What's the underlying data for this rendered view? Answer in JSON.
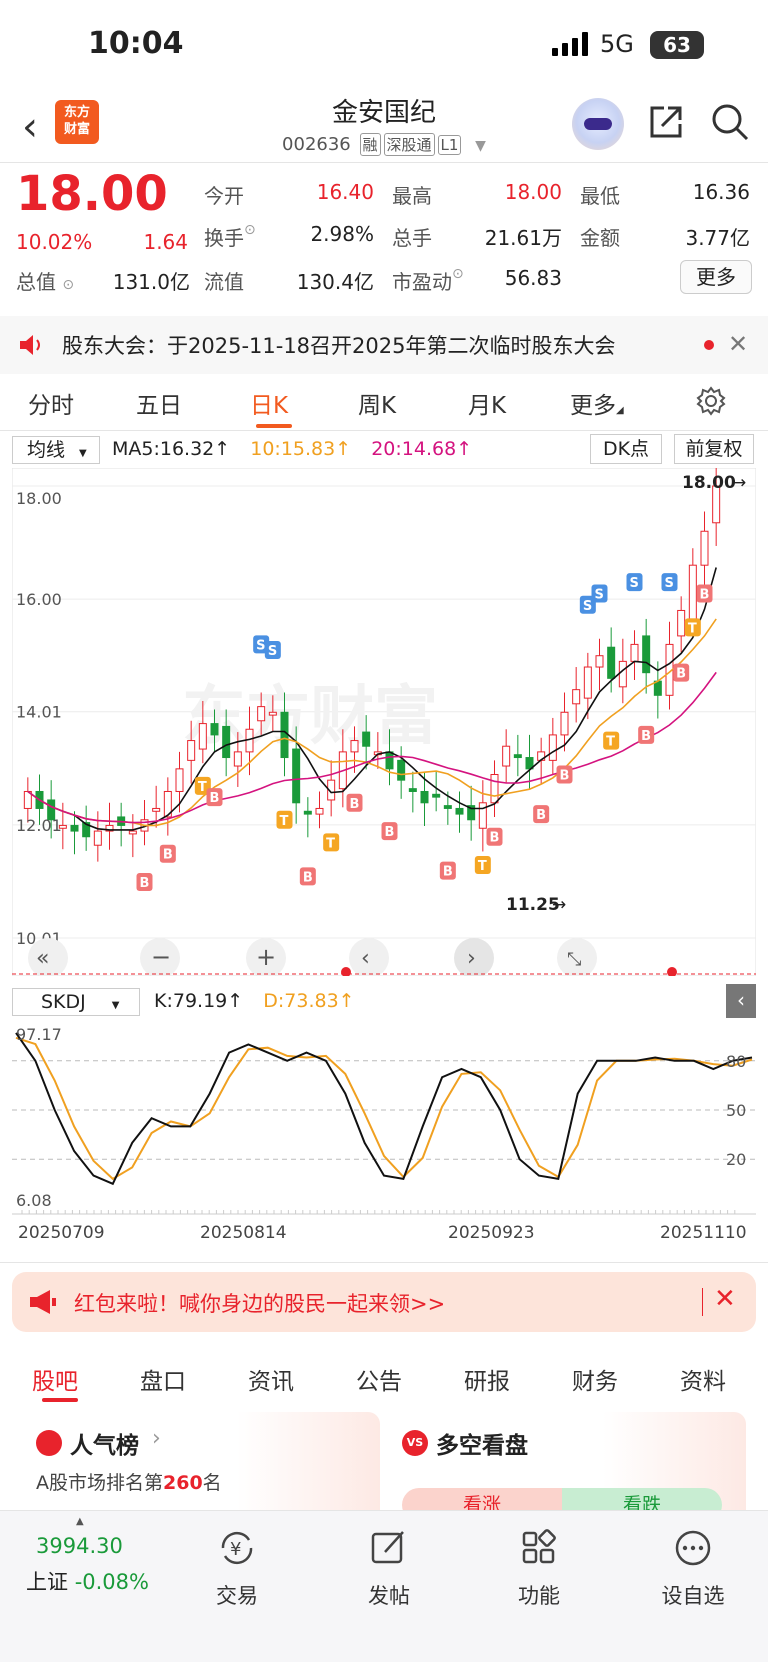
{
  "status_bar": {
    "time": "10:04",
    "network": "5G",
    "battery": "63"
  },
  "header": {
    "logo_text": "东方财富",
    "stock_name": "金安国纪",
    "stock_code": "002636",
    "tags": [
      "融",
      "深股通",
      "L1"
    ]
  },
  "quote": {
    "price": "18.00",
    "change_pct": "10.02%",
    "change": "1.64",
    "total_value_label": "总值",
    "total_value": "131.0亿",
    "fields": [
      {
        "label": "今开",
        "value": "16.40",
        "color": "#e8232c"
      },
      {
        "label": "最高",
        "value": "18.00",
        "color": "#e8232c"
      },
      {
        "label": "最低",
        "value": "16.36",
        "color": "#222222"
      },
      {
        "label": "换手",
        "value": "2.98%",
        "color": "#222222"
      },
      {
        "label": "总手",
        "value": "21.61万",
        "color": "#222222"
      },
      {
        "label": "金额",
        "value": "3.77亿",
        "color": "#222222"
      },
      {
        "label": "流值",
        "value": "130.4亿",
        "color": "#222222"
      },
      {
        "label": "市盈动",
        "value": "56.83",
        "color": "#222222"
      }
    ],
    "more_button": "更多"
  },
  "notice": {
    "text": "股东大会：于2025-11-18召开2025年第二次临时股东大会"
  },
  "chart_tabs": [
    "分时",
    "五日",
    "日K",
    "周K",
    "月K",
    "更多"
  ],
  "active_chart_tab": "日K",
  "ma_bar": {
    "select": "均线",
    "ma5": "MA5:16.32",
    "ma10": "10:15.83",
    "ma20": "20:14.68",
    "dk_button": "DK点",
    "adjust_button": "前复权"
  },
  "kdj_bar": {
    "select": "SKDJ",
    "k": "K:79.19",
    "d": "D:73.83"
  },
  "chart_data": [
    {
      "type": "candlestick",
      "title": "",
      "y_ticks": [
        "18.00",
        "16.00",
        "14.01",
        "12.01",
        "10.01"
      ],
      "ylim": [
        10.01,
        18.0
      ],
      "high_label": "18.00",
      "low_label": "11.25",
      "series": [
        {
          "name": "MA5",
          "color": "#111111"
        },
        {
          "name": "MA10",
          "color": "#f0a020"
        },
        {
          "name": "MA20",
          "color": "#d4137f"
        }
      ]
    },
    {
      "type": "line",
      "title": "",
      "y_ticks_left": [
        "97.17",
        "6.08"
      ],
      "y_ticks_right": [
        "80",
        "50",
        "20"
      ],
      "x_labels": [
        "20250709",
        "20250814",
        "20250923",
        "20251110"
      ],
      "series": [
        {
          "name": "K",
          "color": "#111111"
        },
        {
          "name": "D",
          "color": "#f0a020"
        }
      ]
    }
  ],
  "banner": {
    "text": "红包来啦！喊你身边的股民一起来领>>"
  },
  "bottom_tabs": [
    "股吧",
    "盘口",
    "资讯",
    "公告",
    "研报",
    "财务",
    "资料"
  ],
  "active_bottom_tab": "股吧",
  "cards": [
    {
      "title": "人气榜",
      "subtitle_prefix": "A股市场排名第",
      "rank": "260",
      "subtitle_suffix": "名"
    },
    {
      "title": "多空看盘",
      "bull": "看涨",
      "bear": "看跌"
    }
  ],
  "bottom_nav": {
    "index_value": "3994.30",
    "index_label": "上证",
    "index_change": "-0.08%",
    "items": [
      "交易",
      "发帖",
      "功能",
      "设自选"
    ]
  }
}
